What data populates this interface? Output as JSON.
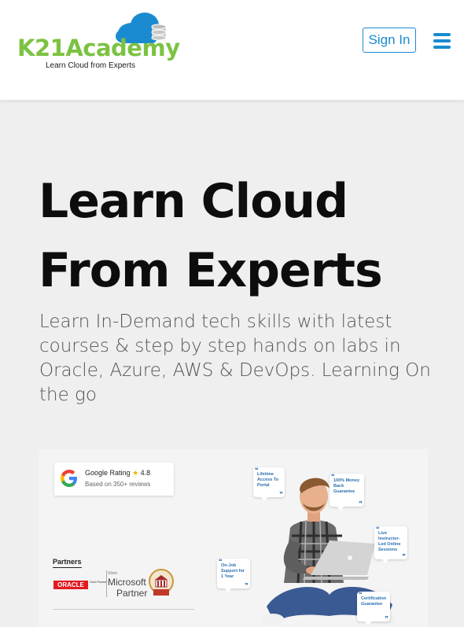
{
  "brand": {
    "name_k": "K21",
    "name_rest": "Academy",
    "tagline": "Learn Cloud from Experts",
    "colors": {
      "green": "#7cc242",
      "blue": "#1a8bd0"
    }
  },
  "header": {
    "signin_label": "Sign In",
    "menu_icon": "hamburger-icon"
  },
  "hero": {
    "title_line1": "Learn Cloud",
    "title_line2": "From Experts",
    "subtitle": "Learn In-Demand tech skills with latest courses & step by step hands on labs in Oracle, Azure, AWS & DevOps. Learning On the go"
  },
  "banner": {
    "rating_label": "Google Rating",
    "rating_value": "4.8",
    "rating_sub": "Based on 350+ reviews",
    "partners_label": "Partners",
    "oracle_label": "ORACLE",
    "oracle_tier": "Gold Partner",
    "ms_tier": "Silver",
    "ms_name": "Microsoft",
    "ms_partner": "Partner",
    "bubbles": [
      {
        "text": "Lifetime Access To Portal"
      },
      {
        "text": "100% Money Back Guarantee"
      },
      {
        "text": "Live Instructor-Led Online Sessions"
      },
      {
        "text": "On-Job Support for 1 Year"
      },
      {
        "text": "Certification Guarantee"
      }
    ]
  }
}
